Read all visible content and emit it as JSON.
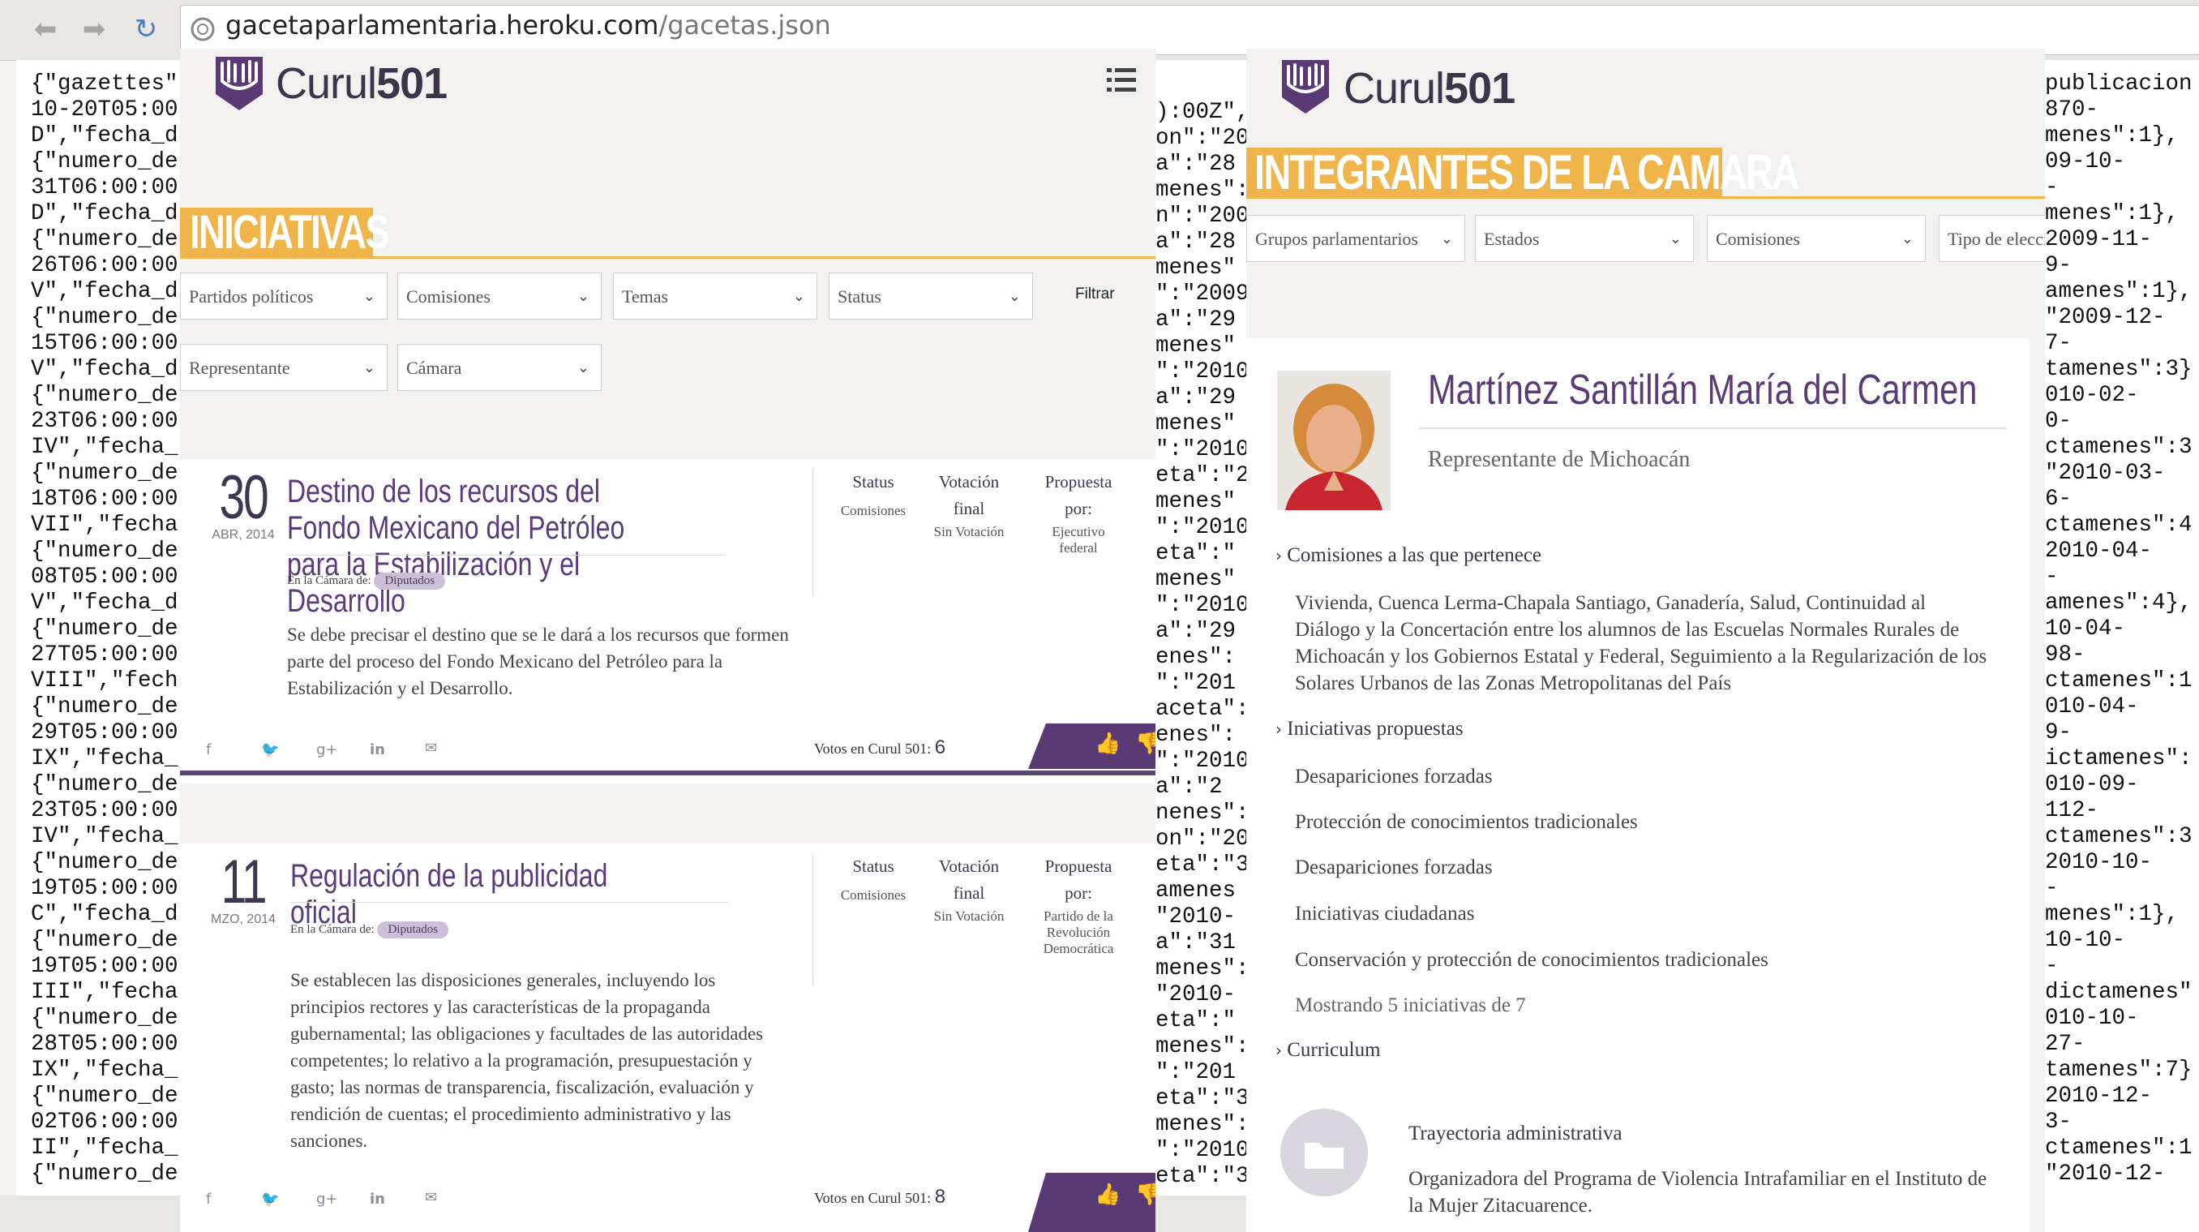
{
  "browser": {
    "url_domain": "gacetaparlamentaria.heroku.com",
    "url_path": "/gacetas.json"
  },
  "json_left": "{\"gazettes\"\n10-20T05:00\nD\",\"fecha_d\n{\"numero_de\n31T06:00:00\nD\",\"fecha_d\n{\"numero_de\n26T06:00:00\nV\",\"fecha_d\n{\"numero_de\n15T06:00:00\nV\",\"fecha_d\n{\"numero_de\n23T06:00:00\nIV\",\"fecha_\n{\"numero_de\n18T06:00:00\nVII\",\"fecha\n{\"numero_de\n08T05:00:00\nV\",\"fecha_d\n{\"numero_de\n27T05:00:00\nVIII\",\"fech\n{\"numero_de\n29T05:00:00\nIX\",\"fecha_\n{\"numero_de\n23T05:00:00\nIV\",\"fecha_\n{\"numero_de\n19T05:00:00\nC\",\"fecha_d\n{\"numero_de\n19T05:00:00\nIII\",\"fecha\n{\"numero_de\n28T05:00:00\nIX\",\"fecha_\n{\"numero_de\n02T06:00:00\nII\",\"fecha_\n{\"numero_de",
  "json_middle": "):00Z\",\non\":\"20\na\":\"28\nmenes\":\nn\":\"2009-\na\":\"28\nmenes\"\n\":\"2009\na\":\"29\nmenes\"\n\":\"2010\na\":\"29\nmenes\"\n\":\"2010\neta\":\"2\nmenes\"\n\":\"2010\neta\":\"\nmenes\"\n\":\"2010-\na\":\"29\nenes\":\n\":\"201\naceta\":\nenes\":\n\":\"2010\na\":\"2\nnenes\":\non\":\"20\neta\":\"3\namenes\n\"2010-\na\":\"31\nmenes\":\n\"2010-\neta\":\"\nmenes\":\n\":\"201\neta\":\"3\nmenes\":\n\":\"2010\neta\":\"3\namenes",
  "json_right": "publicacion\n870-\nmenes\":1},\n09-10-\n-\nmenes\":1},\n2009-11-\n9-\namenes\":1},\n\"2009-12-\n7-\ntamenes\":3}\n010-02-\n0-\nctamenes\":3\n\"2010-03-\n6-\nctamenes\":4\n2010-04-\n-\namenes\":4},\n10-04-\n98-\nctamenes\":1\n010-04-\n9-\nictamenes\":\n010-09-\n112-\nctamenes\":3\n2010-10-\n-\nmenes\":1},\n10-10-\n-\ndictamenes\"\n010-10-\n27-\ntamenes\":7}\n2010-12-\n3-\nctamenes\":1\n\"2010-12-",
  "logo": {
    "curul": "Curul",
    "num": "501"
  },
  "iniciativas": {
    "banner": "INICIATIVAS",
    "filters": [
      "Partidos políticos",
      "Comisiones",
      "Temas",
      "Status",
      "Representante",
      "Cámara"
    ],
    "filter_button": "Filtrar",
    "cards": [
      {
        "day": "30",
        "month": "ABR, 2014",
        "title": "Destino de los recursos del Fondo Mexicano del Petróleo para la Estabilización y el Desarrollo",
        "camara_label": "En la Cámara de:",
        "camara": "Diputados",
        "description": "Se debe precisar el destino que se le dará a los recursos que formen parte del proceso del Fondo Mexicano del Petróleo para la Estabilización y el Desarrollo.",
        "status_head": "Status",
        "status": "Comisiones",
        "votacion_head": "Votación final",
        "votacion": "Sin Votación",
        "propuesta_head": "Propuesta por:",
        "propuesta": "Ejecutivo federal",
        "votes_label": "Votos en Curul 501:",
        "votes": "6"
      },
      {
        "day": "11",
        "month": "MZO, 2014",
        "title": "Regulación de la publicidad oficial",
        "camara_label": "En la Cámara de:",
        "camara": "Diputados",
        "description": "Se establecen las disposiciones generales, incluyendo los principios rectores y las características de la propaganda gubernamental; las obligaciones y facultades de las autoridades competentes; lo relativo a la programación, presupuestación y gasto; las normas de transparencia, fiscalización, evaluación y rendición de cuentas; el procedimiento administrativo y las sanciones.",
        "status_head": "Status",
        "status": "Comisiones",
        "votacion_head": "Votación final",
        "votacion": "Sin Votación",
        "propuesta_head": "Propuesta por:",
        "propuesta": "Partido de la Revolución Democrática",
        "votes_label": "Votos en Curul 501:",
        "votes": "8"
      }
    ]
  },
  "integrantes": {
    "banner": "INTEGRANTES DE LA CAMARA",
    "filters": [
      "Grupos parlamentarios",
      "Estados",
      "Comisiones",
      "Tipo de elección"
    ],
    "name": "Martínez Santillán María del Carmen",
    "subtitle": "Representante de Michoacán",
    "comisiones_head": "Comisiones a las que pertenece",
    "comisiones": "Vivienda, Cuenca Lerma-Chapala Santiago, Ganadería, Salud, Continuidad al Diálogo y la Concertación entre los alumnos de las Escuelas Normales Rurales de Michoacán y los Gobiernos Estatal y Federal, Seguimiento a la Regularización de los Solares Urbanos de las Zonas Metropolitanas del País",
    "iniciativas_head": "Iniciativas propuestas",
    "iniciativas": [
      "Desapariciones forzadas",
      "Protección de conocimientos tradicionales",
      "Desapariciones forzadas",
      "Iniciativas ciudadanas",
      "Conservación y protección de conocimientos tradicionales"
    ],
    "mostrando": "Mostrando 5 iniciativas de 7",
    "curriculum_head": "Curriculum",
    "trayectoria_head": "Trayectoria administrativa",
    "trayectoria": "Organizadora del Programa de Violencia Intrafamiliar en el Instituto de la Mujer Zitacuarence."
  },
  "colors": {
    "accent": "#efb54a",
    "brand": "#5a3a74"
  }
}
